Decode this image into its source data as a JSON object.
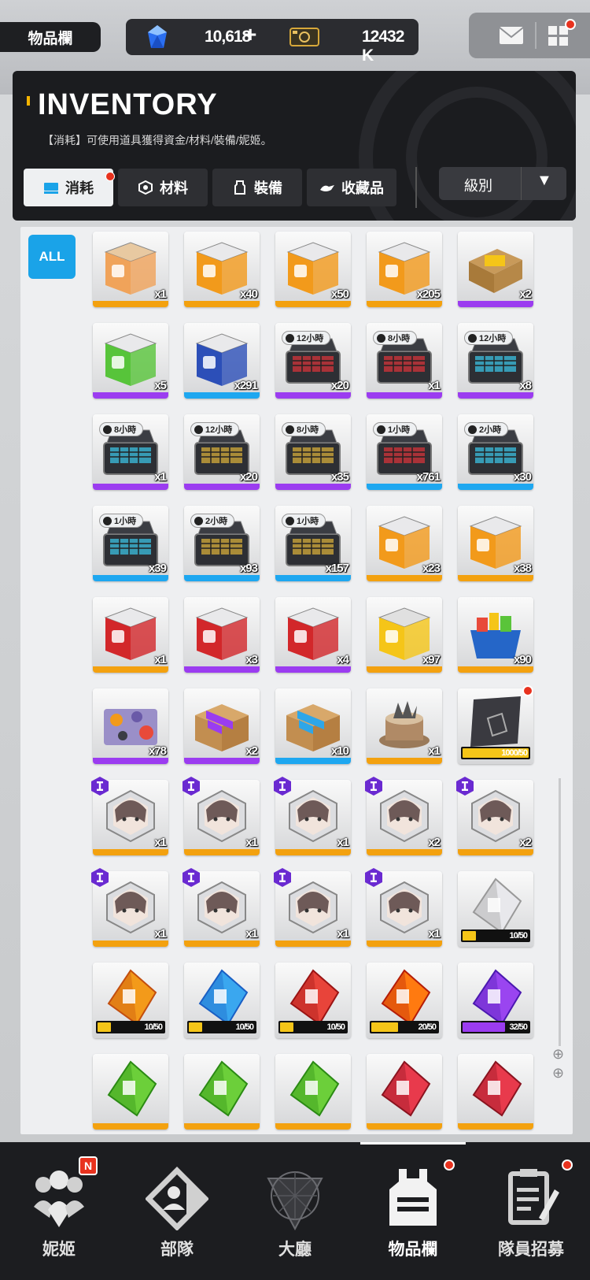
{
  "top_bar": {
    "page_tag": "物品欄",
    "gems": "10,618",
    "gems_plus": "+",
    "credits": "12432 K"
  },
  "header": {
    "title": "INVENTORY",
    "subtitle": "【消耗】可使用道具獲得資金/材料/裝備/妮姬。",
    "tabs": [
      {
        "label": "消耗",
        "active": true
      },
      {
        "label": "材料",
        "active": false
      },
      {
        "label": "裝備",
        "active": false
      },
      {
        "label": "收藏品",
        "active": false
      }
    ],
    "sort_label": "級別",
    "sort_arrow": "▼"
  },
  "filter": {
    "all_label": "ALL"
  },
  "items": [
    {
      "kind": "gift",
      "rarity": "SSR",
      "qty": "x1"
    },
    {
      "kind": "crate-orange",
      "rarity": "SSR",
      "qty": "x40"
    },
    {
      "kind": "crate-orange",
      "rarity": "SSR",
      "qty": "x50"
    },
    {
      "kind": "crate-orange",
      "rarity": "SSR",
      "qty": "x205"
    },
    {
      "kind": "box-gold",
      "rarity": "SR",
      "qty": "x2"
    },
    {
      "kind": "crate-green",
      "rarity": "SR",
      "qty": "x5"
    },
    {
      "kind": "crate-blue",
      "rarity": "R",
      "qty": "x291"
    },
    {
      "kind": "case-red",
      "rarity": "SR",
      "qty": "x20",
      "timer": "12小時"
    },
    {
      "kind": "case-red",
      "rarity": "SR",
      "qty": "x1",
      "timer": "8小時"
    },
    {
      "kind": "case-cyan",
      "rarity": "SR",
      "qty": "x8",
      "timer": "12小時"
    },
    {
      "kind": "case-cyan",
      "rarity": "SR",
      "qty": "x1",
      "timer": "8小時"
    },
    {
      "kind": "case-gold",
      "rarity": "SR",
      "qty": "x20",
      "timer": "12小時"
    },
    {
      "kind": "case-gold",
      "rarity": "SR",
      "qty": "x35",
      "timer": "8小時"
    },
    {
      "kind": "case-red",
      "rarity": "R",
      "qty": "x761",
      "timer": "1小時"
    },
    {
      "kind": "case-cyan",
      "rarity": "R",
      "qty": "x30",
      "timer": "2小時"
    },
    {
      "kind": "case-cyan",
      "rarity": "R",
      "qty": "x39",
      "timer": "1小時"
    },
    {
      "kind": "case-gold",
      "rarity": "R",
      "qty": "x93",
      "timer": "2小時"
    },
    {
      "kind": "case-gold",
      "rarity": "R",
      "qty": "x157",
      "timer": "1小時"
    },
    {
      "kind": "crate-orange",
      "rarity": "SSR",
      "qty": "x23"
    },
    {
      "kind": "crate-orange",
      "rarity": "SSR",
      "qty": "x38"
    },
    {
      "kind": "crate-red",
      "rarity": "SSR",
      "qty": "x1"
    },
    {
      "kind": "crate-red",
      "rarity": "SR",
      "qty": "x3"
    },
    {
      "kind": "crate-red",
      "rarity": "SR",
      "qty": "x4"
    },
    {
      "kind": "crate-white",
      "rarity": "SSR",
      "qty": "x97"
    },
    {
      "kind": "basket",
      "rarity": "SSR",
      "qty": "x90"
    },
    {
      "kind": "camo-case",
      "rarity": "SR",
      "qty": "x78"
    },
    {
      "kind": "parcel-purple",
      "rarity": "SR",
      "qty": "x2"
    },
    {
      "kind": "parcel-blue",
      "rarity": "R",
      "qty": "x10"
    },
    {
      "kind": "cake",
      "rarity": "SSR",
      "qty": "x1"
    },
    {
      "kind": "card-dark",
      "rarity": "SSR",
      "progress": "1000/50",
      "fill": 1.0,
      "dot": true
    },
    {
      "kind": "portrait",
      "rarity": "SSR",
      "qty": "x1",
      "badge": true
    },
    {
      "kind": "portrait",
      "rarity": "SSR",
      "qty": "x1",
      "badge": true
    },
    {
      "kind": "portrait",
      "rarity": "SSR",
      "qty": "x1",
      "badge": true
    },
    {
      "kind": "portrait",
      "rarity": "SSR",
      "qty": "x2",
      "badge": true
    },
    {
      "kind": "portrait",
      "rarity": "SSR",
      "qty": "x2",
      "badge": true
    },
    {
      "kind": "portrait",
      "rarity": "SSR",
      "qty": "x1",
      "badge": true
    },
    {
      "kind": "portrait",
      "rarity": "SSR",
      "qty": "x1",
      "badge": true
    },
    {
      "kind": "portrait",
      "rarity": "SSR",
      "qty": "x1",
      "badge": true
    },
    {
      "kind": "portrait",
      "rarity": "SSR",
      "qty": "x1",
      "badge": true
    },
    {
      "kind": "shard-white",
      "rarity": "SSR",
      "progress": "10/50",
      "fill": 0.2
    },
    {
      "kind": "shard-orange",
      "rarity": "SSR",
      "progress": "10/50",
      "fill": 0.2
    },
    {
      "kind": "shard-blue",
      "rarity": "SSR",
      "progress": "10/50",
      "fill": 0.2
    },
    {
      "kind": "shard-red",
      "rarity": "SSR",
      "progress": "10/50",
      "fill": 0.2
    },
    {
      "kind": "shard-fire",
      "rarity": "SSR",
      "progress": "20/50",
      "fill": 0.4
    },
    {
      "kind": "shard-purple",
      "rarity": "SR",
      "progress": "32/50",
      "fill": 0.64
    },
    {
      "kind": "shard-green",
      "rarity": "SSR",
      "qty": ""
    },
    {
      "kind": "shard-green",
      "rarity": "SSR",
      "qty": ""
    },
    {
      "kind": "shard-green",
      "rarity": "SSR",
      "qty": ""
    },
    {
      "kind": "shard-crimson",
      "rarity": "SSR",
      "qty": ""
    },
    {
      "kind": "shard-crimson",
      "rarity": "SSR",
      "qty": ""
    }
  ],
  "rarity_colors": {
    "SSR": "#f3a10f",
    "SR": "#9b3cf0",
    "R": "#1ea7f0"
  },
  "nav": [
    {
      "label": "妮姬",
      "icon": "nikke-icon",
      "badge": "N"
    },
    {
      "label": "部隊",
      "icon": "squad-icon"
    },
    {
      "label": "大廳",
      "icon": "lobby-icon"
    },
    {
      "label": "物品欄",
      "icon": "inventory-icon",
      "active": true,
      "dot": true
    },
    {
      "label": "隊員招募",
      "icon": "recruit-icon",
      "dot": true
    }
  ]
}
